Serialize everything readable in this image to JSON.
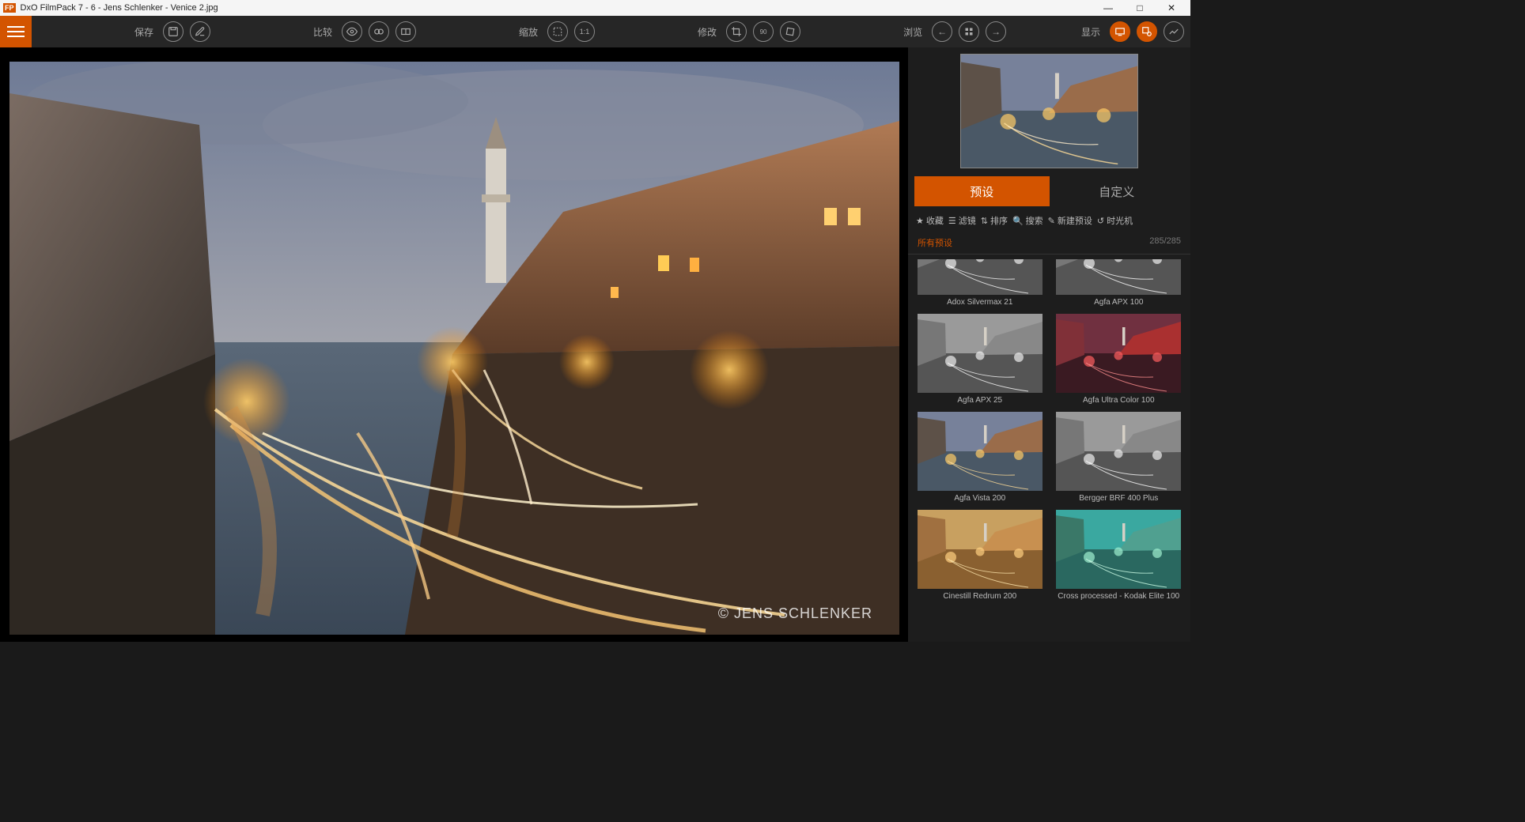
{
  "titlebar": {
    "text": "DxO FilmPack 7 - 6 - Jens Schlenker - Venice 2.jpg"
  },
  "toolbar": {
    "save": "保存",
    "compare": "比较",
    "zoom": "缩放",
    "zoom_11": "1:1",
    "modify": "修改",
    "browse": "浏览",
    "display": "显示"
  },
  "viewer": {
    "watermark": "© JENS SCHLENKER"
  },
  "panel": {
    "tabs": {
      "preset": "预设",
      "custom": "自定义"
    },
    "filters": {
      "favorites": "收藏",
      "filter": "滤镜",
      "sort": "排序",
      "search": "搜索",
      "new_preset": "新建预设",
      "time_machine": "时光机"
    },
    "section": {
      "title": "所有预设",
      "count": "285/285"
    },
    "presets": [
      {
        "name": "Adox Silvermax 21",
        "style": "bw"
      },
      {
        "name": "Agfa APX 100",
        "style": "bw"
      },
      {
        "name": "Agfa APX 25",
        "style": "bw"
      },
      {
        "name": "Agfa Ultra Color 100",
        "style": "red"
      },
      {
        "name": "Agfa Vista 200",
        "style": "warm"
      },
      {
        "name": "Bergger BRF 400 Plus",
        "style": "bw"
      },
      {
        "name": "Cinestill Redrum 200",
        "style": "sepia"
      },
      {
        "name": "Cross processed - Kodak Elite 100",
        "style": "teal"
      }
    ]
  }
}
